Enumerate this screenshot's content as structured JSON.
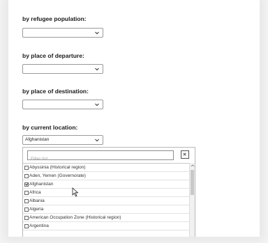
{
  "filters": {
    "refugee_population": {
      "label": "by refugee population:",
      "value": ""
    },
    "place_of_departure": {
      "label": "by place of departure:",
      "value": ""
    },
    "place_of_destination": {
      "label": "by place of destination:",
      "value": ""
    },
    "current_location": {
      "label": "by current location:",
      "value": "Afghanistan"
    }
  },
  "location_list": {
    "filter_placeholder": "Filter list",
    "clear_icon": "close-icon",
    "options": [
      {
        "label": "Abyssinia (Historical region)",
        "checked": false
      },
      {
        "label": "Aden, Yemen (Governorate)",
        "checked": false
      },
      {
        "label": "Afghanistan",
        "checked": true
      },
      {
        "label": "Africa",
        "checked": false
      },
      {
        "label": "Albania",
        "checked": false
      },
      {
        "label": "Algeria",
        "checked": false
      },
      {
        "label": "American Occupation Zone (Historical region)",
        "checked": false
      },
      {
        "label": "Argentina",
        "checked": false
      }
    ]
  },
  "colors": {
    "border": "#9a9a9a",
    "text": "#1a1a1a",
    "background": "#ffffff"
  }
}
